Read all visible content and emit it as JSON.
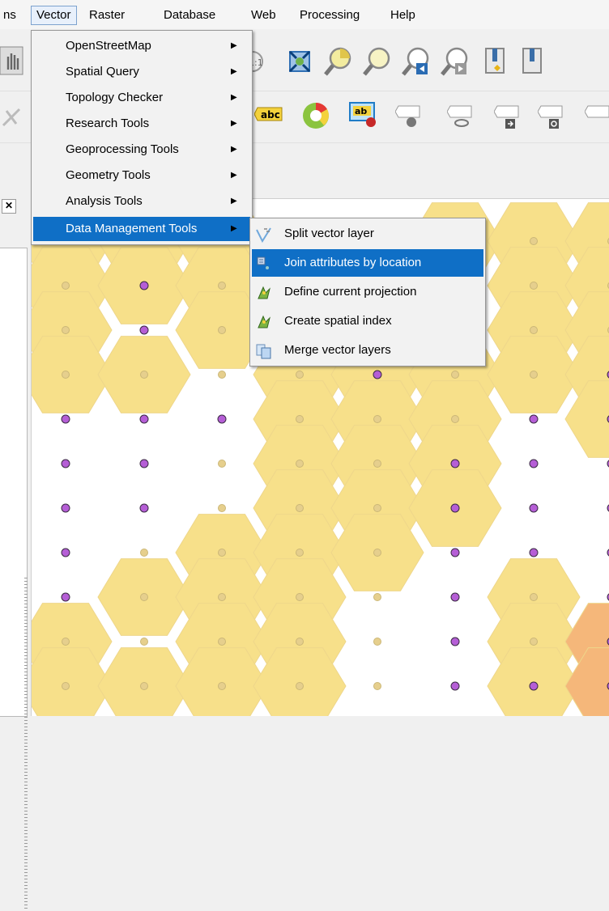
{
  "menubar": {
    "items": [
      {
        "label": "ns"
      },
      {
        "label": "Vector"
      },
      {
        "label": "Raster"
      },
      {
        "label": "Database"
      },
      {
        "label": "Web"
      },
      {
        "label": "Processing"
      },
      {
        "label": "Help"
      }
    ]
  },
  "vector_menu": {
    "items": [
      {
        "label": "OpenStreetMap"
      },
      {
        "label": "Spatial Query"
      },
      {
        "label": "Topology Checker"
      },
      {
        "label": "Research Tools"
      },
      {
        "label": "Geoprocessing Tools"
      },
      {
        "label": "Geometry Tools"
      },
      {
        "label": "Analysis Tools"
      },
      {
        "label": "Data Management Tools"
      }
    ],
    "highlighted": "Data Management Tools"
  },
  "data_management_submenu": {
    "items": [
      {
        "label": "Split vector layer",
        "icon": "split-layer-icon"
      },
      {
        "label": "Join attributes by location",
        "icon": "join-attributes-icon"
      },
      {
        "label": "Define current projection",
        "icon": "projection-icon"
      },
      {
        "label": "Create spatial index",
        "icon": "spatial-index-icon"
      },
      {
        "label": "Merge vector layers",
        "icon": "merge-layers-icon"
      }
    ],
    "highlighted": "Join attributes by location"
  },
  "toolbar": {
    "label_tool_text": "abc",
    "label_small_text": "ab"
  },
  "colors": {
    "menu_highlight": "#0f6fc6",
    "hex_fill": "#f7e08a",
    "hex_orange": "#f5b77a",
    "point_purple": "#b55ed6",
    "point_faded": "#e6cf8d"
  }
}
